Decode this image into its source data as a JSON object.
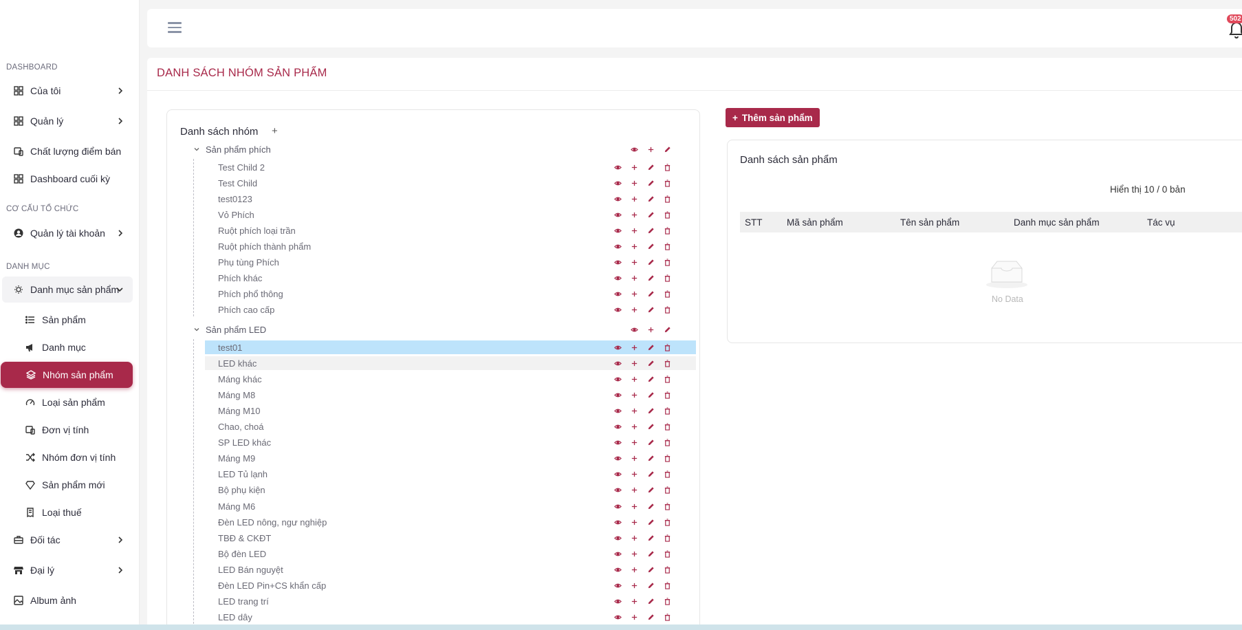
{
  "sidebar": {
    "sections": [
      "DASHBOARD",
      "CƠ CẤU TỔ CHỨC",
      "DANH MỤC"
    ],
    "items": [
      {
        "label": "Của tôi",
        "icon": "grid-icon"
      },
      {
        "label": "Quản lý",
        "icon": "grid-icon"
      },
      {
        "label": "Chất lượng điểm bán",
        "icon": "devices-icon"
      },
      {
        "label": "Dashboard cuối kỳ",
        "icon": "grid-icon"
      },
      {
        "label": "Quản lý tài khoản",
        "icon": "user-circle-icon"
      },
      {
        "label": "Danh mục sản phẩm",
        "icon": "bulb-icon"
      },
      {
        "label": "Sản phẩm",
        "icon": "list-icon"
      },
      {
        "label": "Danh mục",
        "icon": "megaphone-icon"
      },
      {
        "label": "Nhóm sản phẩm",
        "icon": "layers-icon"
      },
      {
        "label": "Loại sản phẩm",
        "icon": "gauge-icon"
      },
      {
        "label": "Đơn vị tính",
        "icon": "devices-icon"
      },
      {
        "label": "Nhóm đơn vị tính",
        "icon": "shuffle-icon"
      },
      {
        "label": "Sản phẩm mới",
        "icon": "diamond-icon"
      },
      {
        "label": "Loại thuế",
        "icon": "receipt-icon"
      },
      {
        "label": "Đối tác",
        "icon": "briefcase-icon"
      },
      {
        "label": "Đại lý",
        "icon": "store-icon"
      },
      {
        "label": "Album ảnh",
        "icon": "image-icon"
      }
    ]
  },
  "topbar": {
    "notification_count": "502"
  },
  "page": {
    "title": "DANH SÁCH NHÓM SẢN PHẨM"
  },
  "groups": {
    "title": "Danh sách nhóm",
    "add": "+",
    "tree": [
      {
        "label": "Sản phẩm phích",
        "children": [
          "Test Child 2",
          "Test Child",
          "test0123",
          "Vỏ Phích",
          "Ruột phích loại trần",
          "Ruột phích thành phẩm",
          "Phụ tùng Phích",
          "Phích khác",
          "Phích phổ thông",
          "Phích cao cấp"
        ]
      },
      {
        "label": "Sản phẩm LED",
        "children": [
          "test01",
          "LED khác",
          "Máng khác",
          "Máng M8",
          "Máng M10",
          "Chao, choá",
          "SP LED khác",
          "Máng M9",
          "LED Tủ lạnh",
          "Bộ phụ kiện",
          "Máng M6",
          "Đèn LED nông, ngư nghiệp",
          "TBĐ & CKĐT",
          "Bộ đèn LED",
          "LED Bán nguyệt",
          "Đèn LED Pin+CS khẩn cấp",
          "LED trang trí",
          "LED dây"
        ]
      }
    ]
  },
  "products": {
    "add_button": "Thêm sản phẩm",
    "title": "Danh sách sản phẩm",
    "showing": "Hiển thị 10 / 0 bản",
    "columns": [
      "STT",
      "Mã sản phẩm",
      "Tên sản phẩm",
      "Danh mục sản phẩm",
      "Tác vụ"
    ],
    "empty": "No Data"
  },
  "colors": {
    "accent": "#a8294a",
    "selected_row": "#bde3fb"
  }
}
